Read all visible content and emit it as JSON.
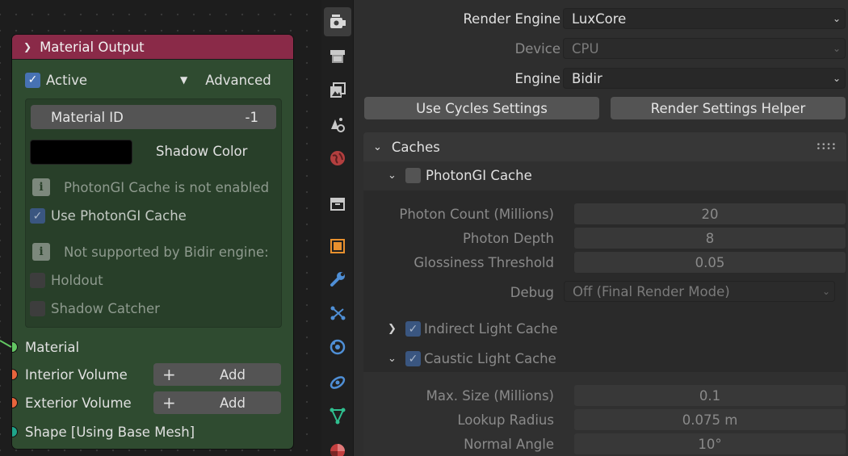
{
  "node": {
    "title": "Material Output",
    "active_label": "Active",
    "advanced_label": "Advanced",
    "material_id_label": "Material ID",
    "material_id_value": "-1",
    "shadow_color_label": "Shadow Color",
    "photongi_info": "PhotonGI Cache is not enabled",
    "use_photongi_label": "Use PhotonGI Cache",
    "bidir_info": "Not supported by Bidir engine:",
    "holdout_label": "Holdout",
    "shadow_catcher_label": "Shadow Catcher",
    "sockets": [
      {
        "label": "Material",
        "color": "#63c763"
      },
      {
        "label": "Interior Volume",
        "color": "#e8653c"
      },
      {
        "label": "Exterior Volume",
        "color": "#e8653c"
      },
      {
        "label": "Shape [Using Base Mesh]",
        "color": "#1fa58a"
      }
    ],
    "add_label": "Add",
    "header_color": "#8a2a48",
    "body_color": "#2f4b30"
  },
  "tabs": [
    "render-icon",
    "output-icon",
    "view-layer-icon",
    "scene-icon",
    "world-icon",
    "collection-icon",
    "object-icon",
    "modifier-icon",
    "particles-icon",
    "physics-icon",
    "constraints-icon",
    "data-icon",
    "material-icon"
  ],
  "props": {
    "render_engine_label": "Render Engine",
    "render_engine_value": "LuxCore",
    "device_label": "Device",
    "device_value": "CPU",
    "engine_label": "Engine",
    "engine_value": "Bidir",
    "use_cycles_btn": "Use Cycles Settings",
    "helper_btn": "Render Settings Helper",
    "caches_title": "Caches",
    "photongi_title": "PhotonGI Cache",
    "photon_count_label": "Photon Count (Millions)",
    "photon_count_value": "20",
    "photon_depth_label": "Photon Depth",
    "photon_depth_value": "8",
    "gloss_label": "Glossiness Threshold",
    "gloss_value": "0.05",
    "debug_label": "Debug",
    "debug_value": "Off (Final Render Mode)",
    "indirect_label": "Indirect Light Cache",
    "caustic_label": "Caustic Light Cache",
    "max_size_label": "Max. Size (Millions)",
    "max_size_value": "0.1",
    "lookup_label": "Lookup Radius",
    "lookup_value": "0.075 m",
    "normal_label": "Normal Angle",
    "normal_value": "10°"
  }
}
